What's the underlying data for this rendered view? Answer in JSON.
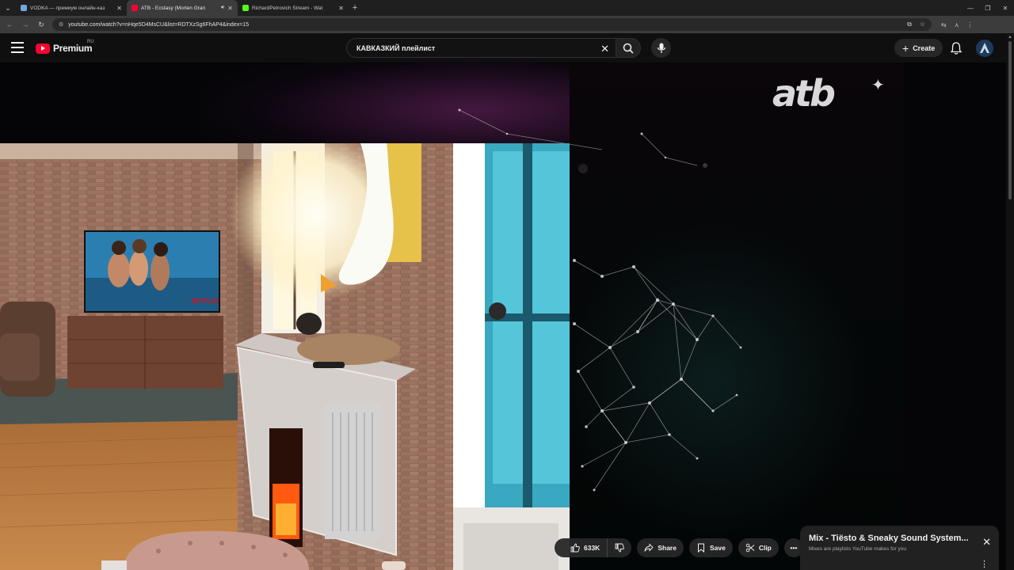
{
  "browser": {
    "tabs": [
      {
        "title": "VODKA — премиум онлайн-каз",
        "favicon_color": "#6fa8dc",
        "active": false
      },
      {
        "title": "ATB - Ecstasy (Morten Gran",
        "favicon_color": "#ff0033",
        "active": true,
        "audio": true
      },
      {
        "title": "RichardPetrovich Stream - Wat",
        "favicon_color": "#53fc18",
        "active": false
      }
    ],
    "url": "youtube.com/watch?v=nHqe5D4MsCU&list=RDTXzSg6FhAP4&index=15"
  },
  "masthead": {
    "logo_text": "Premium",
    "region": "RU",
    "search_query": "КАВКАЗКИЙ плейлист",
    "create_label": "Create"
  },
  "video": {
    "overlay_logo": "atb",
    "tv_label": "NETFLIX"
  },
  "actions": {
    "like_count": "633K",
    "share_label": "Share",
    "save_label": "Save",
    "clip_label": "Clip"
  },
  "mix_card": {
    "title": "Mix - Tiësto & Sneaky Sound System...",
    "subtitle": "Mixes are playlists YouTube makes for you"
  },
  "colors": {
    "brand": "#ff0033",
    "background": "#0f0f0f"
  }
}
